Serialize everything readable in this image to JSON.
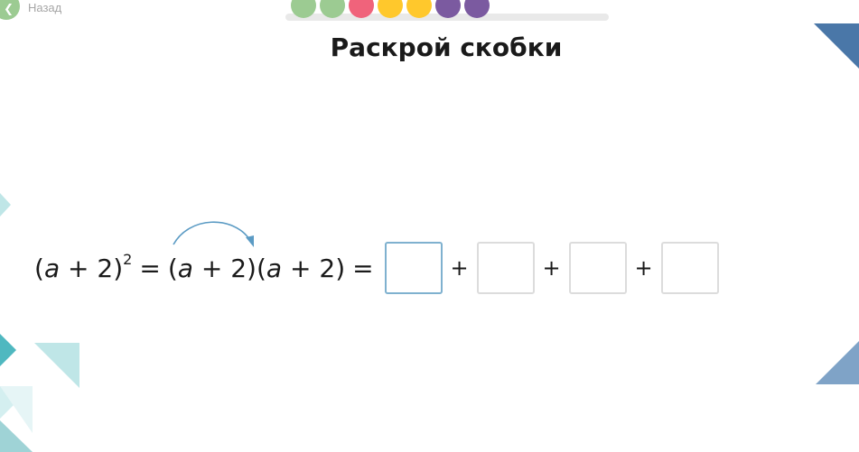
{
  "nav": {
    "back_label": "Назад",
    "back_icon": "chevron-left-icon"
  },
  "progress": {
    "steps": [
      {
        "color": "#9ccb92"
      },
      {
        "color": "#9ccb92"
      },
      {
        "color": "#f0637b"
      },
      {
        "color": "#ffc82c"
      },
      {
        "color": "#ffc82c"
      },
      {
        "color": "#7b5aa0"
      },
      {
        "color": "#7b5aa0"
      }
    ]
  },
  "task": {
    "title": "Раскрой скобки",
    "expression_lhs_base": "(a + 2)",
    "exponent": "2",
    "expression_equals": "=",
    "expression_rhs_factor1": "(a + 2)",
    "expression_rhs_factor2": "(a + 2)",
    "answer_equals": "=",
    "plus_sign": "+",
    "answers": [
      {
        "value": "",
        "active": true
      },
      {
        "value": "",
        "active": false
      },
      {
        "value": "",
        "active": false
      },
      {
        "value": "",
        "active": false
      }
    ]
  },
  "colors": {
    "accent_blue": "#4a77a8",
    "teal": "#4fb8c0",
    "light_teal": "#bfe6e7",
    "arc": "#5b9bc4",
    "active_border": "#7fb1cf"
  }
}
